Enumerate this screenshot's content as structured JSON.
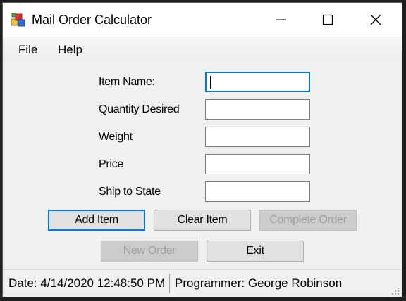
{
  "window": {
    "title": "Mail Order Calculator",
    "icon": "app-icon",
    "controls": [
      "minimize-icon",
      "maximize-icon",
      "close-icon"
    ]
  },
  "menu": {
    "file": "File",
    "help": "Help"
  },
  "fields": [
    {
      "label": "Item Name:",
      "value": ""
    },
    {
      "label": "Quantity Desired",
      "value": ""
    },
    {
      "label": "Weight",
      "value": ""
    },
    {
      "label": "Price",
      "value": ""
    },
    {
      "label": "Ship to State",
      "value": ""
    }
  ],
  "buttons": {
    "add_item": "Add Item",
    "clear_item": "Clear Item",
    "complete_order": "Complete Order",
    "new_order": "New Order",
    "exit": "Exit"
  },
  "status": {
    "date": "Date: 4/14/2020 12:48:50 PM",
    "programmer": "Programmer: George Robinson"
  },
  "colors": {
    "focus_accent": "#0078d7",
    "window_bg": "#f0f0f0",
    "disabled_text": "#a0a0a0"
  }
}
